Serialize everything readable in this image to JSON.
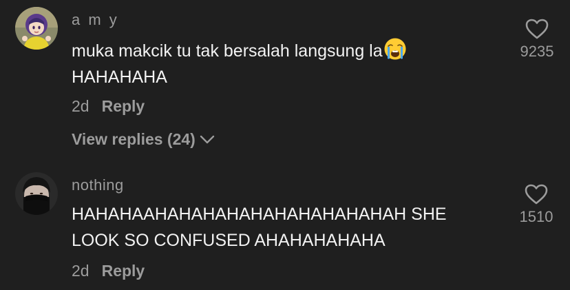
{
  "comments": [
    {
      "username": "a m y",
      "text": "muka makcik tu tak bersalah langsung la",
      "text_line2": "HAHAHAHA",
      "emoji": "loudly-crying-face",
      "time": "2d",
      "reply_label": "Reply",
      "view_replies_label": "View replies (24)",
      "likes": "9235"
    },
    {
      "username": "nothing",
      "text": "HAHAHAAHAHAHAHAHAHAHAHAHAHAH SHE",
      "text_line2": "LOOK SO CONFUSED AHAHAHAHAHA",
      "time": "2d",
      "reply_label": "Reply",
      "likes": "1510"
    }
  ],
  "colors": {
    "background": "#1f1f1f",
    "primary_text": "#f2f2f2",
    "secondary_text": "#9c9c9c"
  },
  "icons": [
    "heart-outline-icon",
    "chevron-down-icon",
    "loudly-crying-face-emoji"
  ]
}
